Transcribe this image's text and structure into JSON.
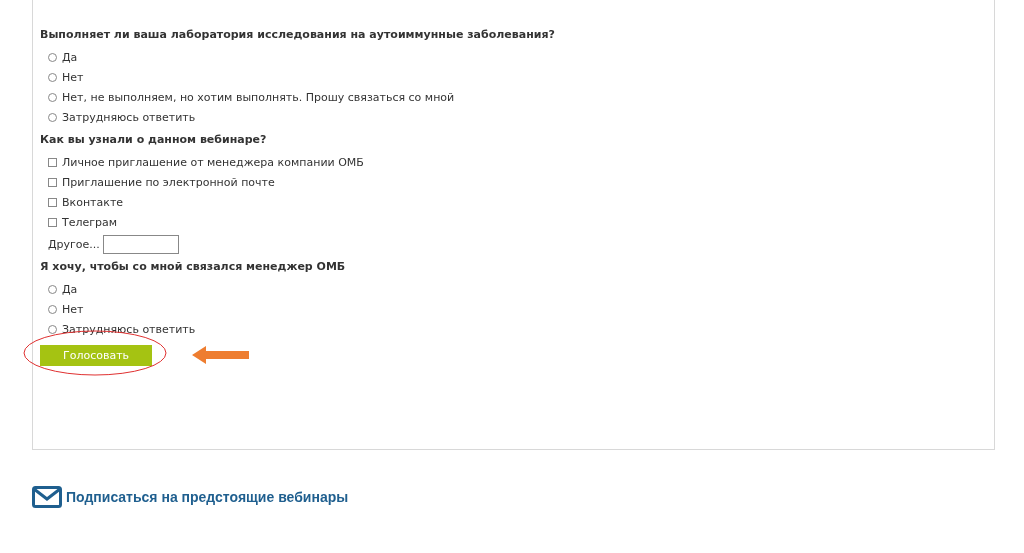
{
  "questions": [
    {
      "kind": "radio",
      "title": "Выполняет ли ваша лаборатория исследования на аутоиммунные заболевания?",
      "options": [
        {
          "label": "Да",
          "checked": false
        },
        {
          "label": "Нет",
          "checked": false
        },
        {
          "label": "Нет, не выполняем, но хотим выполнять. Прошу связаться со мной",
          "checked": false
        },
        {
          "label": "Затрудняюсь ответить",
          "checked": false
        }
      ]
    },
    {
      "kind": "checkbox",
      "title": "Как вы узнали о данном вебинаре?",
      "options": [
        {
          "label": "Личное приглашение от менеджера компании ОМБ",
          "checked": false
        },
        {
          "label": "Приглашение по электронной почте",
          "checked": false
        },
        {
          "label": "Вконтакте",
          "checked": false
        },
        {
          "label": "Телеграм",
          "checked": false
        }
      ],
      "other": {
        "label": "Другое..."
      }
    },
    {
      "kind": "radio",
      "title": "Я хочу, чтобы со мной связался менеджер ОМБ",
      "options": [
        {
          "label": "Да",
          "checked": false
        },
        {
          "label": "Нет",
          "checked": false
        },
        {
          "label": "Затрудняюсь ответить",
          "checked": false
        }
      ]
    }
  ],
  "submit": {
    "label": "Голосовать"
  },
  "subscribe_link": "Подписаться на предстоящие вебинары"
}
